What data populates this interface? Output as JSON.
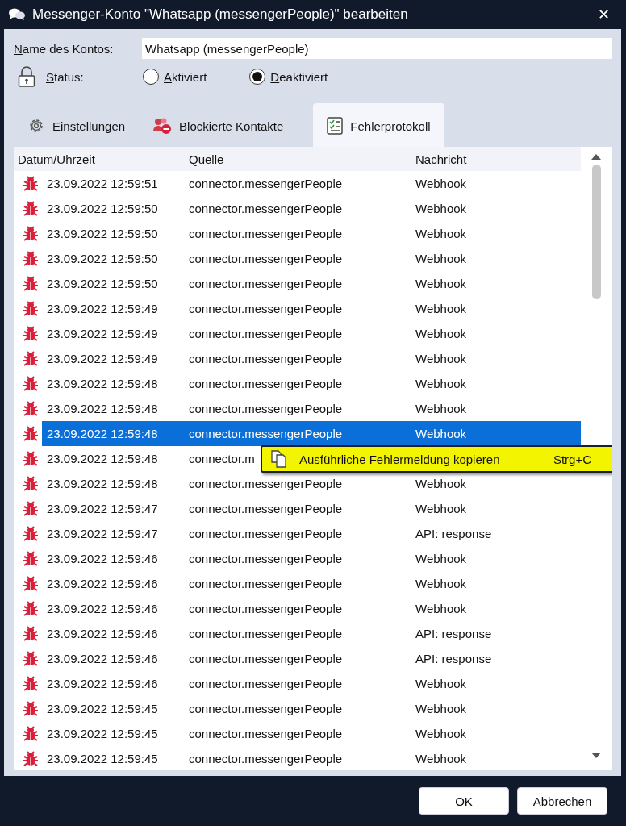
{
  "window": {
    "title": "Messenger-Konto \"Whatsapp (messengerPeople)\" bearbeiten",
    "close": "✕"
  },
  "account_name": {
    "label": "Name des Kontos:",
    "value": "Whatsapp (messengerPeople)"
  },
  "status": {
    "label": "Status:",
    "options": [
      {
        "label": "Aktiviert",
        "selected": false
      },
      {
        "label": "Deaktiviert",
        "selected": true
      }
    ]
  },
  "tabs": [
    {
      "label": "Einstellungen",
      "kind": "gear",
      "selected": false
    },
    {
      "label": "Blockierte Kontakte",
      "kind": "blocked",
      "selected": false
    },
    {
      "label": "Fehlerprotokoll",
      "kind": "checklist",
      "selected": true
    }
  ],
  "table": {
    "columns": [
      "Datum/Uhrzeit",
      "Quelle",
      "Nachricht"
    ],
    "rows": [
      {
        "datetime": "23.09.2022 12:59:51",
        "source": "connector.messengerPeople",
        "message": "Webhook",
        "selected": false
      },
      {
        "datetime": "23.09.2022 12:59:50",
        "source": "connector.messengerPeople",
        "message": "Webhook",
        "selected": false
      },
      {
        "datetime": "23.09.2022 12:59:50",
        "source": "connector.messengerPeople",
        "message": "Webhook",
        "selected": false
      },
      {
        "datetime": "23.09.2022 12:59:50",
        "source": "connector.messengerPeople",
        "message": "Webhook",
        "selected": false
      },
      {
        "datetime": "23.09.2022 12:59:50",
        "source": "connector.messengerPeople",
        "message": "Webhook",
        "selected": false
      },
      {
        "datetime": "23.09.2022 12:59:49",
        "source": "connector.messengerPeople",
        "message": "Webhook",
        "selected": false
      },
      {
        "datetime": "23.09.2022 12:59:49",
        "source": "connector.messengerPeople",
        "message": "Webhook",
        "selected": false
      },
      {
        "datetime": "23.09.2022 12:59:49",
        "source": "connector.messengerPeople",
        "message": "Webhook",
        "selected": false
      },
      {
        "datetime": "23.09.2022 12:59:48",
        "source": "connector.messengerPeople",
        "message": "Webhook",
        "selected": false
      },
      {
        "datetime": "23.09.2022 12:59:48",
        "source": "connector.messengerPeople",
        "message": "Webhook",
        "selected": false
      },
      {
        "datetime": "23.09.2022 12:59:48",
        "source": "connector.messengerPeople",
        "message": "Webhook",
        "selected": true
      },
      {
        "datetime": "23.09.2022 12:59:48",
        "source": "connector.m",
        "selected": false
      },
      {
        "datetime": "23.09.2022 12:59:48",
        "source": "connector.messengerPeople",
        "message": "Webhook",
        "selected": false
      },
      {
        "datetime": "23.09.2022 12:59:47",
        "source": "connector.messengerPeople",
        "message": "Webhook",
        "selected": false
      },
      {
        "datetime": "23.09.2022 12:59:47",
        "source": "connector.messengerPeople",
        "message": "API: response",
        "selected": false
      },
      {
        "datetime": "23.09.2022 12:59:46",
        "source": "connector.messengerPeople",
        "message": "Webhook",
        "selected": false
      },
      {
        "datetime": "23.09.2022 12:59:46",
        "source": "connector.messengerPeople",
        "message": "Webhook",
        "selected": false
      },
      {
        "datetime": "23.09.2022 12:59:46",
        "source": "connector.messengerPeople",
        "message": "Webhook",
        "selected": false
      },
      {
        "datetime": "23.09.2022 12:59:46",
        "source": "connector.messengerPeople",
        "message": "API: response",
        "selected": false
      },
      {
        "datetime": "23.09.2022 12:59:46",
        "source": "connector.messengerPeople",
        "message": "API: response",
        "selected": false
      },
      {
        "datetime": "23.09.2022 12:59:46",
        "source": "connector.messengerPeople",
        "message": "Webhook",
        "selected": false
      },
      {
        "datetime": "23.09.2022 12:59:45",
        "source": "connector.messengerPeople",
        "message": "Webhook",
        "selected": false
      },
      {
        "datetime": "23.09.2022 12:59:45",
        "source": "connector.messengerPeople",
        "message": "Webhook",
        "selected": false
      },
      {
        "datetime": "23.09.2022 12:59:45",
        "source": "connector.messengerPeople",
        "message": "Webhook",
        "selected": false
      }
    ]
  },
  "context_menu": {
    "label": "Ausführliche Fehlermeldung kopieren",
    "shortcut": "Strg+C"
  },
  "buttons": [
    {
      "label": "OK"
    },
    {
      "label": "Abbrechen"
    }
  ]
}
